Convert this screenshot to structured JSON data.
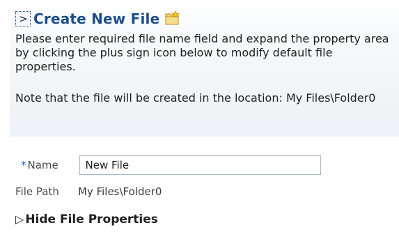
{
  "panel": {
    "title": "Create New File",
    "expand_glyph": ">",
    "instructions": "Please enter required file name field and expand the property area by clicking the plus sign icon below to modify default file properties.",
    "location_note": "Note that the file will be created in the location: My Files\\Folder0",
    "icon": "new-file-icon"
  },
  "form": {
    "required_marker": "*",
    "name_label": "Name",
    "name_value": "New File",
    "path_label": "File Path",
    "path_value": "My Files\\Folder0"
  },
  "properties_toggle": {
    "arrow": "▷",
    "label": "Hide File Properties"
  },
  "colors": {
    "title": "#1c4d8a",
    "required_star": "#0e62c7",
    "input_border": "#aab7c7"
  }
}
